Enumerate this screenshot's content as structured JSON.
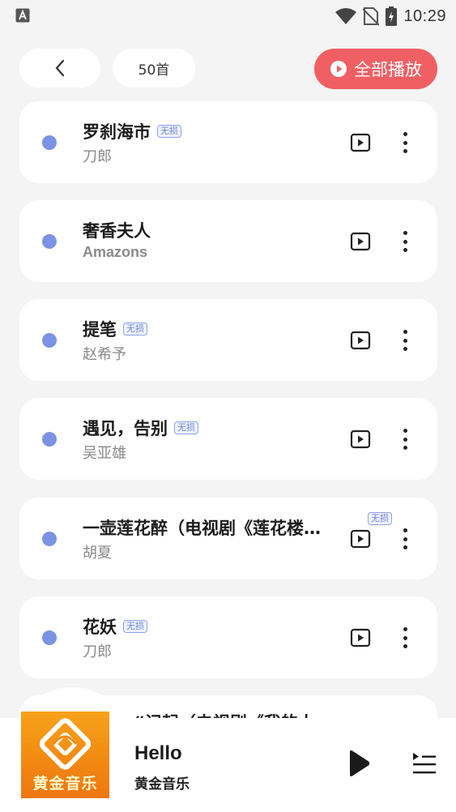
{
  "status_bar": {
    "time": "10:29",
    "left_icon": "a-notification-icon",
    "icons": [
      "wifi-icon",
      "no-sim-icon",
      "battery-charging-icon"
    ]
  },
  "header": {
    "count_label": "50首",
    "play_all_label": "全部播放",
    "accent_color": "#f05f64"
  },
  "songs": [
    {
      "title": "罗刹海市",
      "artist": "刀郎",
      "badge": "无损"
    },
    {
      "title": "奢香夫人",
      "artist": "Amazons",
      "badge": ""
    },
    {
      "title": "提笔",
      "artist": "赵希予",
      "badge": "无损"
    },
    {
      "title": "遇见，告别",
      "artist": "吴亚雄",
      "badge": "无损"
    },
    {
      "title": "一壶莲花醉（电视剧《莲花楼…",
      "artist": "胡夏",
      "badge": "无损"
    },
    {
      "title": "花妖",
      "artist": "刀郎",
      "badge": "无损"
    }
  ],
  "partial_song": {
    "title": "“记起（电视剧《我的人"
  },
  "player": {
    "cover_text": "黄金音乐",
    "title": "Hello",
    "subtitle": "黄金音乐"
  }
}
